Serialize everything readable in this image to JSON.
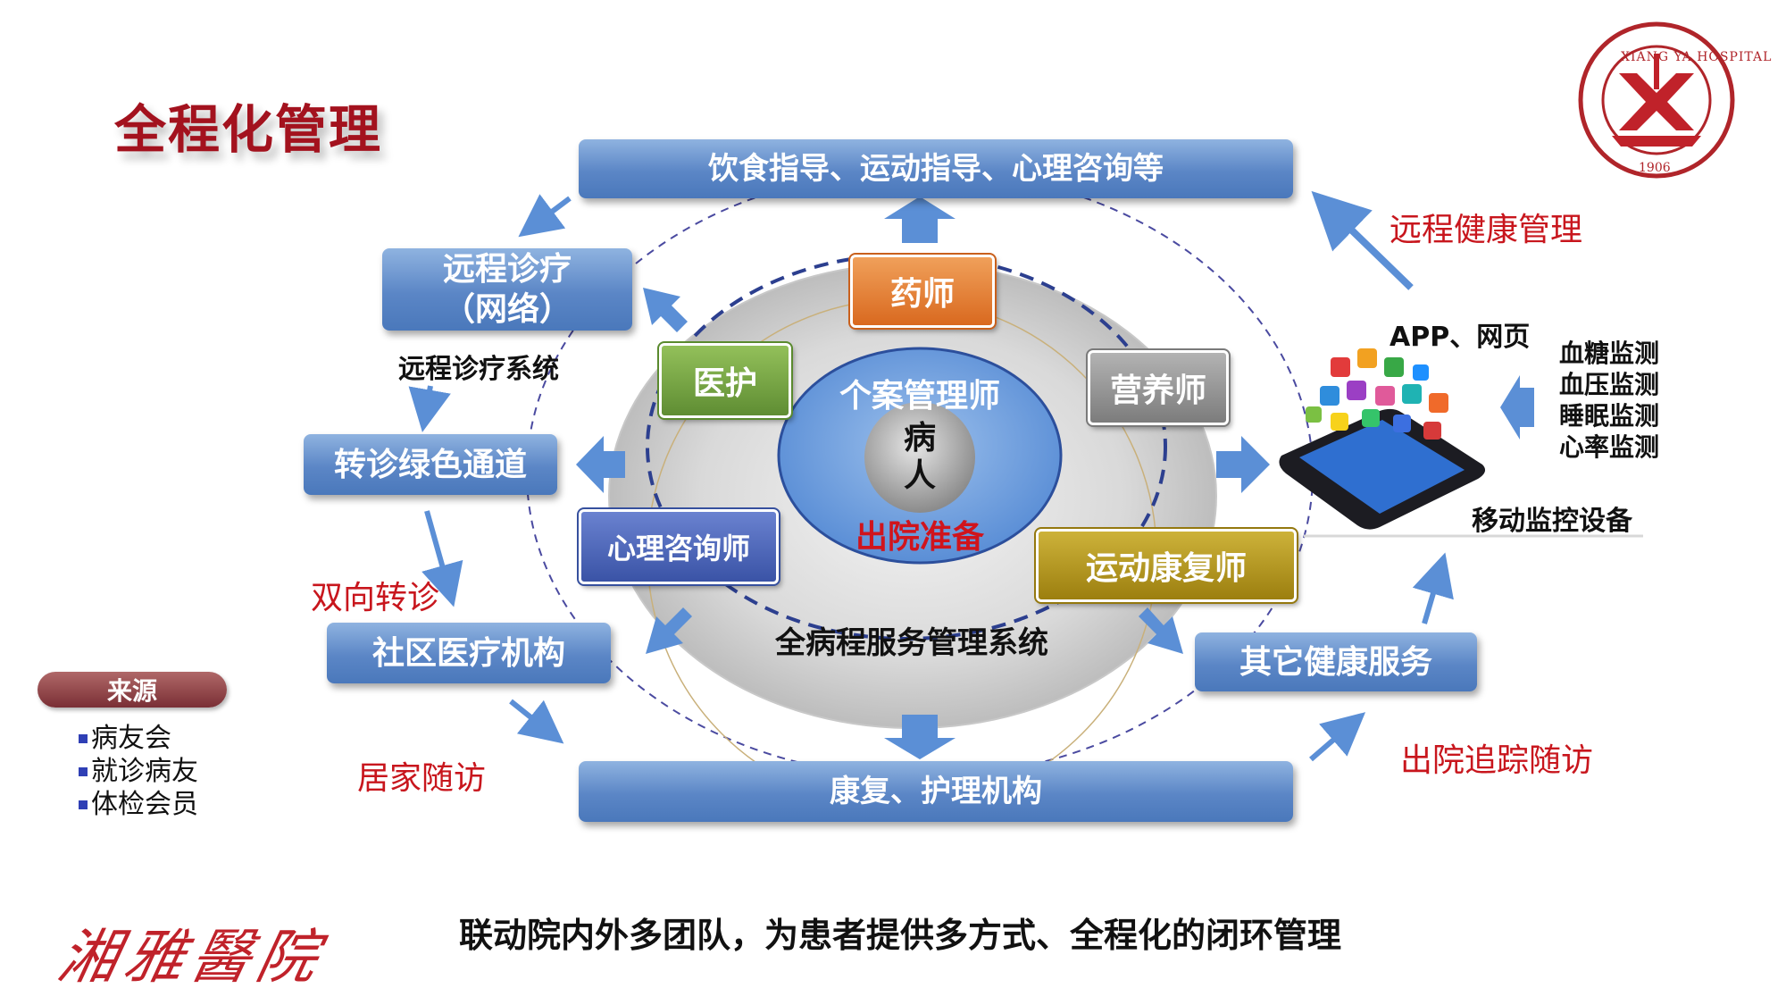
{
  "page_title": "全程化管理",
  "top_box": "饮食指导、运动指导、心理咨询等",
  "bottom_box": "康复、护理机构",
  "left_boxes": {
    "remote_diagnosis_line1": "远程诊疗",
    "remote_diagnosis_line2": "（网络）",
    "remote_system_label": "远程诊疗系统",
    "referral_channel": "转诊绿色通道",
    "community_medical": "社区医疗机构"
  },
  "right_boxes": {
    "other_health": "其它健康服务",
    "app_web": "APP、网页",
    "monitors": [
      "血糖监测",
      "血压监测",
      "睡眠监测",
      "心率监测"
    ],
    "mobile_devices": "移动监控设备"
  },
  "roles": {
    "pharmacist": "药师",
    "nursing": "医护",
    "nutritionist": "营养师",
    "psychologist": "心理咨询师",
    "rehab": "运动康复师"
  },
  "center": {
    "case_manager": "个案管理师",
    "patient_line1": "病",
    "patient_line2": "人",
    "discharge_prep": "出院准备",
    "system_name": "全病程服务管理系统"
  },
  "red_labels": {
    "remote_health": "远程健康管理",
    "two_way_referral": "双向转诊",
    "home_followup": "居家随访",
    "discharge_followup": "出院追踪随访"
  },
  "legend": {
    "title": "来源",
    "items": [
      "病友会",
      "就诊病友",
      "体检会员"
    ]
  },
  "bottom_caption": "联动院内外多团队，为患者提供多方式、全程化的闭环管理",
  "logo": {
    "ring_text": "XIANG YA HOSPITAL",
    "year": "1906",
    "calligraphy": "湘雅醫院"
  },
  "colors": {
    "title_red": "#a3121e",
    "label_red": "#c8161d",
    "box_blue": "#5b86c6",
    "arrow_blue": "#5b8fd6",
    "orange": "#e07a2c",
    "green": "#6e9d3c",
    "gray": "#8a8a8a",
    "navy": "#3c56a8",
    "gold": "#a88a12"
  }
}
